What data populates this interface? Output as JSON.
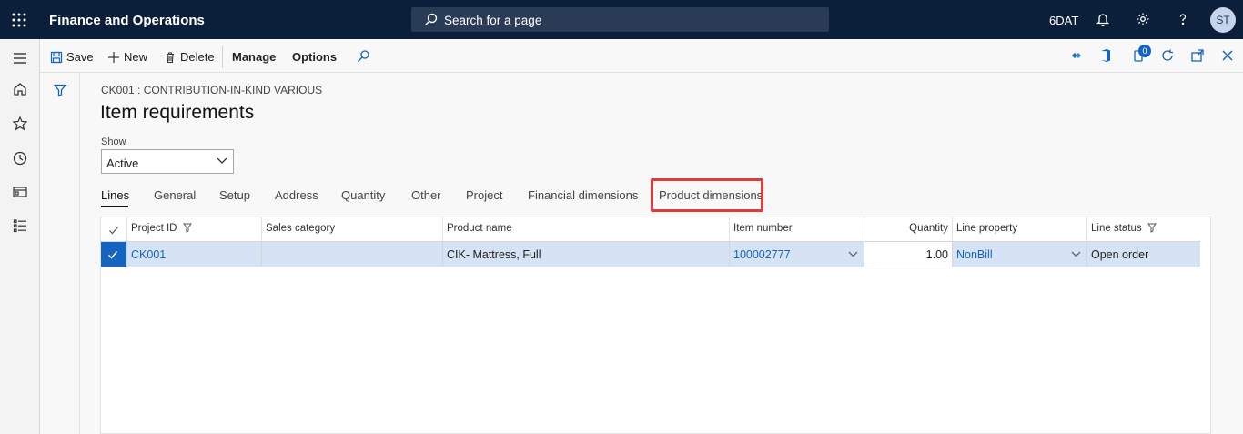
{
  "topbar": {
    "app_title": "Finance and Operations",
    "search_placeholder": "Search for a page",
    "company": "6DAT",
    "avatar_initials": "ST"
  },
  "action_pane": {
    "save": "Save",
    "new": "New",
    "delete": "Delete",
    "manage": "Manage",
    "options": "Options",
    "badge_count": "0"
  },
  "page": {
    "breadcrumb": "CK001 : CONTRIBUTION-IN-KIND VARIOUS",
    "title": "Item requirements",
    "show_label": "Show",
    "show_value": "Active"
  },
  "tabs": [
    {
      "label": "Lines",
      "active": true
    },
    {
      "label": "General"
    },
    {
      "label": "Setup"
    },
    {
      "label": "Address"
    },
    {
      "label": "Quantity"
    },
    {
      "label": "Other"
    },
    {
      "label": "Project"
    },
    {
      "label": "Financial dimensions"
    },
    {
      "label": "Product dimensions",
      "highlighted": true
    }
  ],
  "grid": {
    "columns": [
      "Project ID",
      "Sales category",
      "Product name",
      "Item number",
      "Quantity",
      "Line property",
      "Line status"
    ],
    "rows": [
      {
        "project_id": "CK001",
        "sales_category": "",
        "product_name": "CIK- Mattress, Full",
        "item_number": "100002777",
        "quantity": "1.00",
        "line_property": "NonBill",
        "line_status": "Open order",
        "selected": true
      }
    ]
  },
  "colors": {
    "topbar": "#0b1f3a",
    "selected_row": "#d5e3f5",
    "link": "#1564c0",
    "highlight_box": "#e03c3c"
  }
}
